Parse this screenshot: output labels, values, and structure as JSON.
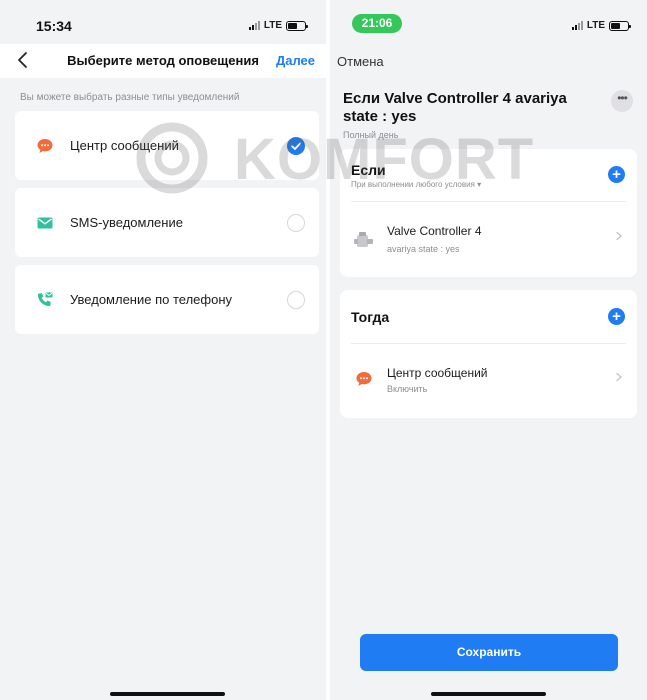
{
  "left": {
    "status": {
      "time": "15:34",
      "network": "LTE"
    },
    "nav": {
      "title": "Выберите метод оповещения",
      "next_label": "Далее"
    },
    "hint": "Вы можете выбрать разные типы уведомлений",
    "options": [
      {
        "label": "Центр сообщений",
        "icon": "message-center-icon",
        "selected": true
      },
      {
        "label": "SMS-уведомление",
        "icon": "envelope-icon",
        "selected": false
      },
      {
        "label": "Уведомление по телефону",
        "icon": "phone-icon",
        "selected": false
      }
    ]
  },
  "right": {
    "status": {
      "time": "21:06",
      "network": "LTE"
    },
    "cancel_label": "Отмена",
    "title": "Если Valve Controller 4 avariya state : yes",
    "subtitle": "Полный день",
    "if_card": {
      "heading": "Если",
      "condition_mode": "При выполнении любого условия",
      "item": {
        "name": "Valve Controller 4",
        "detail": "avariya state : yes",
        "icon": "valve-device-icon"
      }
    },
    "then_card": {
      "heading": "Тогда",
      "item": {
        "name": "Центр сообщений",
        "detail": "Включить",
        "icon": "message-center-icon"
      }
    },
    "save_label": "Сохранить"
  },
  "watermark": {
    "text": "KOMFORT"
  },
  "colors": {
    "accent": "#1f7cf2",
    "message_icon": "#f26b3a",
    "sms_icon": "#2fc29a",
    "status_pill": "#34c759"
  }
}
